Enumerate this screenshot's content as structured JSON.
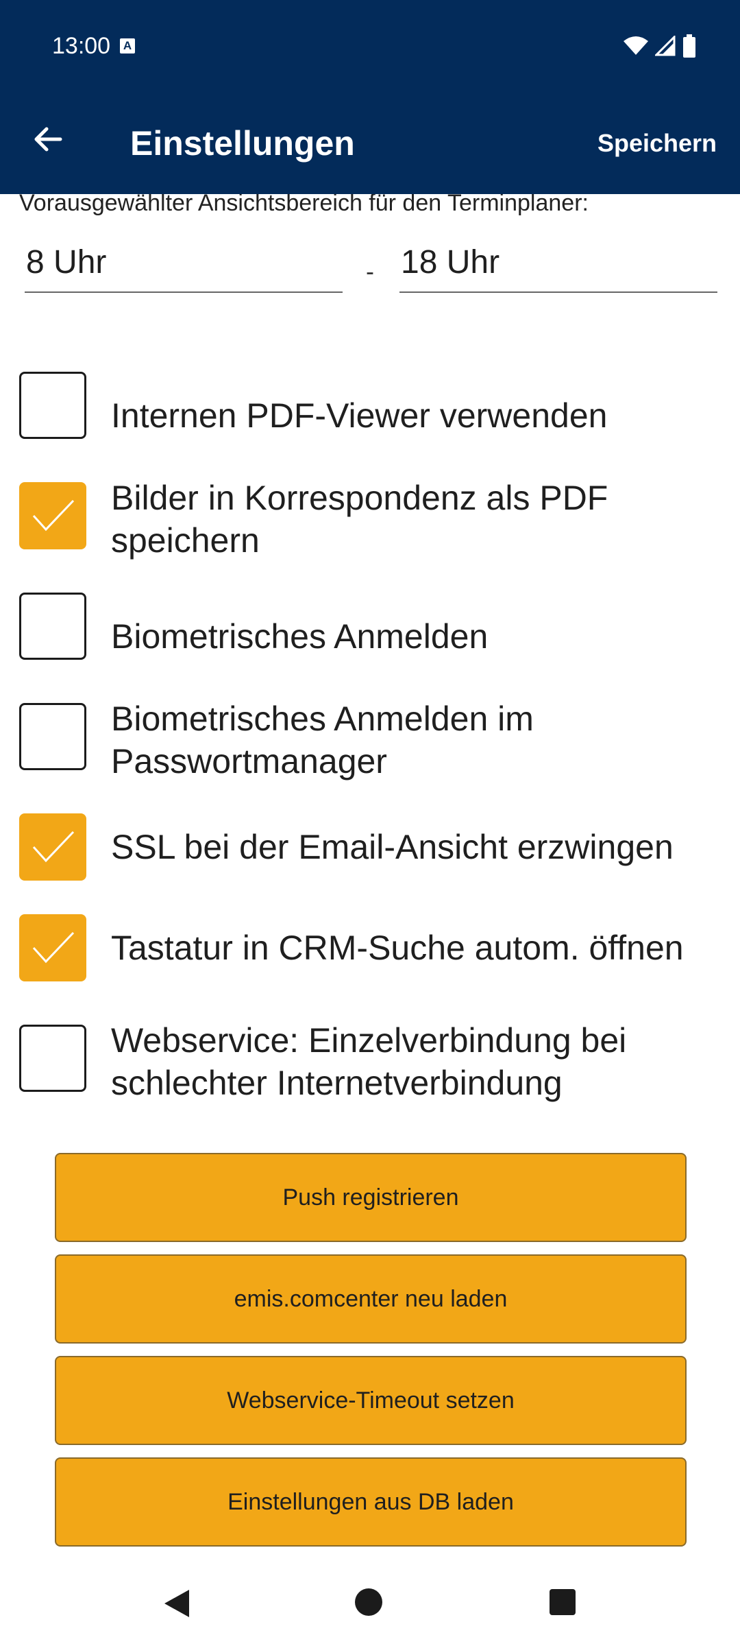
{
  "status": {
    "time": "13:00",
    "notif_letter": "A"
  },
  "header": {
    "title": "Einstellungen",
    "save_label": "Speichern"
  },
  "planner": {
    "hint": "Vorausgewählter Ansichtsbereich für den Terminplaner:",
    "from_value": "8 Uhr",
    "separator": "-",
    "to_value": "18 Uhr"
  },
  "options": [
    {
      "label": "Internen PDF-Viewer verwenden",
      "checked": false
    },
    {
      "label": "Bilder in Korrespondenz als PDF speichern",
      "checked": true
    },
    {
      "label": "Biometrisches Anmelden",
      "checked": false
    },
    {
      "label": "Biometrisches Anmelden im Passwortmanager",
      "checked": false
    },
    {
      "label": "SSL bei der Email-Ansicht erzwingen",
      "checked": true
    },
    {
      "label": "Tastatur in CRM-Suche autom. öffnen",
      "checked": true
    },
    {
      "label": "Webservice: Einzelverbindung bei schlechter Internetverbindung",
      "checked": false
    }
  ],
  "actions": {
    "push": "Push registrieren",
    "reload": "emis.comcenter neu laden",
    "timeout": "Webservice-Timeout setzen",
    "load_db": "Einstellungen aus DB laden"
  },
  "colors": {
    "header_bg": "#032b5a",
    "accent": "#f2a717"
  }
}
